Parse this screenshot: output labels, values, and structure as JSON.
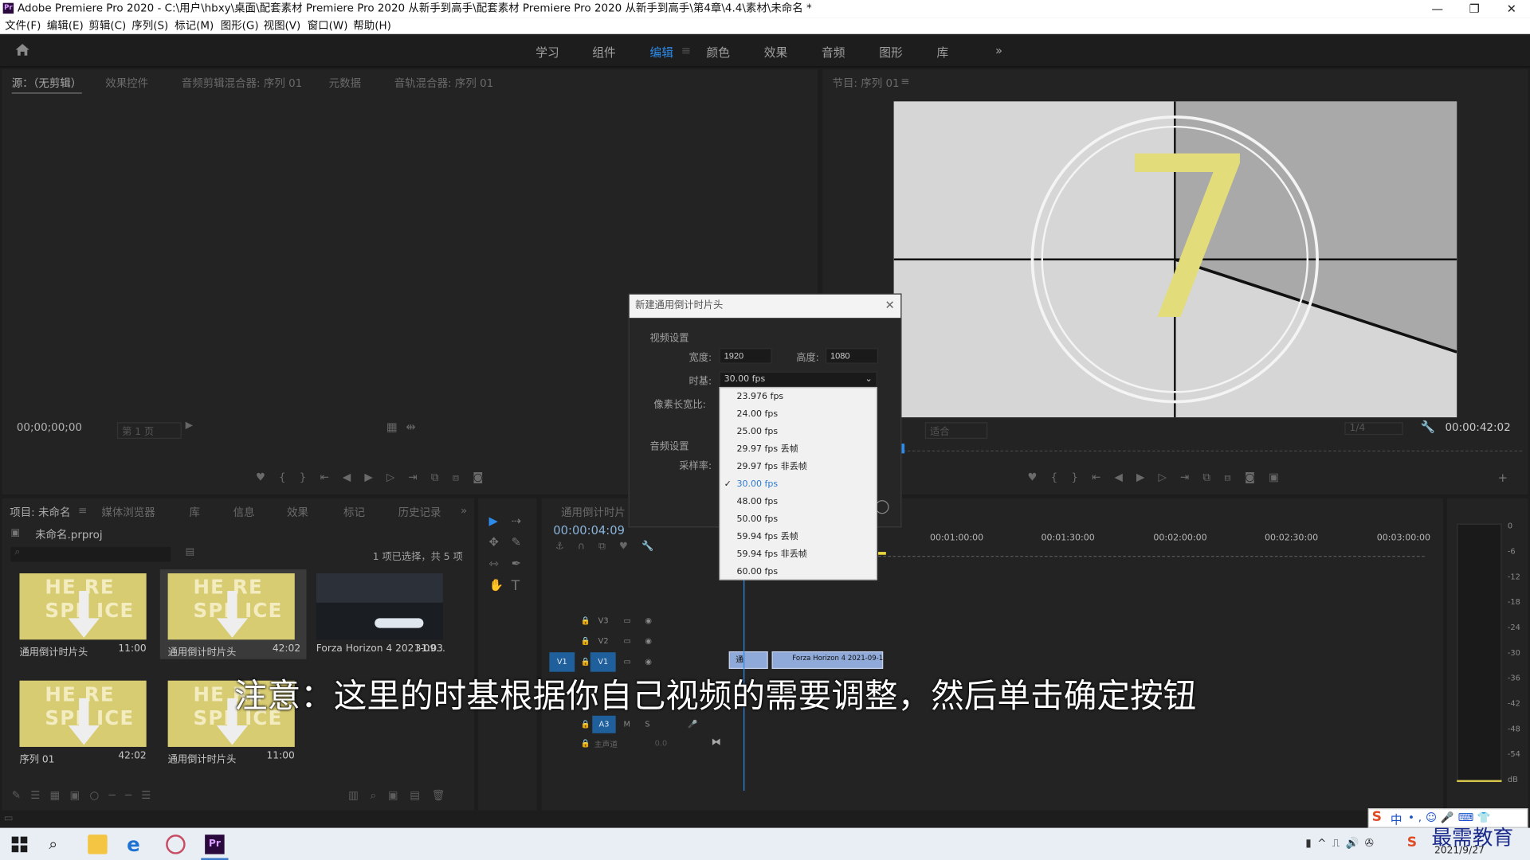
{
  "titlebar": {
    "title": "Adobe Premiere Pro 2020 - C:\\用户\\hbxy\\桌面\\配套素材 Premiere Pro 2020 从新手到高手\\配套素材 Premiere Pro 2020 从新手到高手\\第4章\\4.4\\素材\\未命名 *",
    "minimize": "—",
    "restore": "❐",
    "close": "✕"
  },
  "menu": [
    "文件(F)",
    "编辑(E)",
    "剪辑(C)",
    "序列(S)",
    "标记(M)",
    "图形(G)",
    "视图(V)",
    "窗口(W)",
    "帮助(H)"
  ],
  "workspaces": [
    "学习",
    "组件",
    "编辑",
    "颜色",
    "效果",
    "音频",
    "图形",
    "库"
  ],
  "workspace_more": "»",
  "source_panel": {
    "tabs": [
      "源：（无剪辑）",
      "效果控件",
      "音频剪辑混合器: 序列 01",
      "元数据",
      "音轨混合器: 序列 01"
    ],
    "timecode": "00;00;00;00",
    "page": "第 1 页"
  },
  "program_panel": {
    "tab": "节目: 序列 01",
    "countdown_number": "7",
    "fit": "适合",
    "quality": "1/4",
    "timecode": "00:00:42:02"
  },
  "dialog": {
    "title": "新建通用倒计时片头",
    "video_section": "视频设置",
    "width_label": "宽度:",
    "width_value": "1920",
    "height_label": "高度:",
    "height_value": "1080",
    "timebase_label": "时基:",
    "timebase_value": "30.00 fps",
    "par_label": "像素长宽比:",
    "audio_section": "音频设置",
    "sample_label": "采样率:"
  },
  "timebase_options": [
    {
      "label": "23.976 fps",
      "selected": false
    },
    {
      "label": "24.00 fps",
      "selected": false
    },
    {
      "label": "25.00 fps",
      "selected": false
    },
    {
      "label": "29.97  fps 丢帧",
      "selected": false
    },
    {
      "label": "29.97  fps 非丢帧",
      "selected": false
    },
    {
      "label": "30.00 fps",
      "selected": true
    },
    {
      "label": "48.00 fps",
      "selected": false
    },
    {
      "label": "50.00 fps",
      "selected": false
    },
    {
      "label": "59.94  fps 丢帧",
      "selected": false
    },
    {
      "label": "59.94  fps 非丢帧",
      "selected": false
    },
    {
      "label": "60.00 fps",
      "selected": false
    }
  ],
  "project_panel": {
    "tabs": [
      "项目: 未命名",
      "媒体浏览器",
      "库",
      "信息",
      "效果",
      "标记",
      "历史记录"
    ],
    "project_file": "未命名.prproj",
    "selection_status": "1 项已选择，共 5 项",
    "items": [
      {
        "name": "通用倒计时片头",
        "duration": "11:00"
      },
      {
        "name": "通用倒计时片头",
        "duration": "42:02"
      },
      {
        "name": "Forza Horizon 4 2021-09...",
        "duration": "31:03"
      },
      {
        "name": "序列 01",
        "duration": "42:02"
      },
      {
        "name": "通用倒计时片头",
        "duration": "11:00"
      }
    ],
    "thumb_text": "HE RE SPL ICE"
  },
  "timeline": {
    "tab": "通用倒计时片",
    "timecode": "00:00:04:09",
    "ruler": [
      "00:01:00:00",
      "00:01:30:00",
      "00:02:00:00",
      "00:02:30:00",
      "00:03:00:00"
    ],
    "tracks": [
      "V3",
      "V2",
      "V1",
      "A3",
      "主声道"
    ],
    "source_patch": "V1",
    "master_value": "0.0",
    "clip1": "通",
    "clip2": "Forza Horizon 4 2021-09-1"
  },
  "meter_labels": [
    "0",
    "-6",
    "-12",
    "-18",
    "-24",
    "-30",
    "-36",
    "-42",
    "-48",
    "-54",
    "dB"
  ],
  "subtitle": "注意：这里的时基根据你自己视频的需要调整，然后单击确定按钮",
  "taskbar": {
    "ime": "中",
    "watermark": "最需教育",
    "date": "2021/9/27"
  }
}
